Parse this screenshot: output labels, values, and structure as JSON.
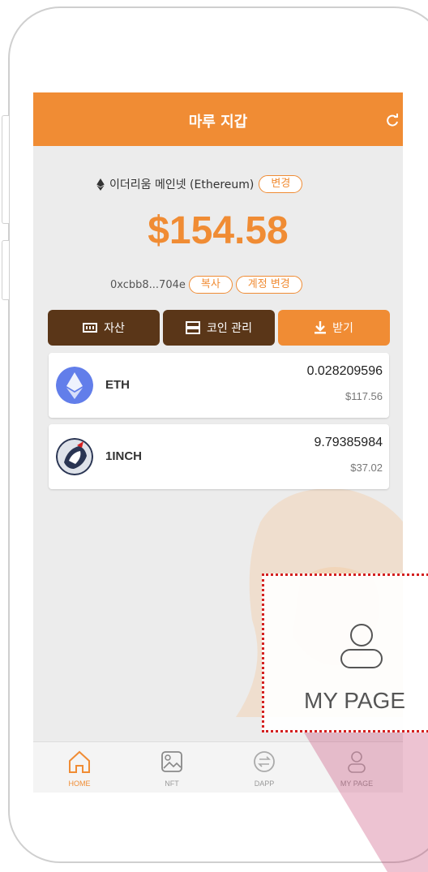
{
  "app": {
    "title": "마루 지갑"
  },
  "network": {
    "label": "이더리움 메인넷 (Ethereum)",
    "change_label": "변경"
  },
  "balance": {
    "total": "$154.58"
  },
  "account": {
    "address": "0xcbb8...704e",
    "copy_label": "복사",
    "switch_label": "계정 변경"
  },
  "actions": {
    "assets": "자산",
    "manage": "코인 관리",
    "receive": "받기"
  },
  "coins": [
    {
      "symbol": "ETH",
      "amount": "0.028209596",
      "usd": "$117.56"
    },
    {
      "symbol": "1INCH",
      "amount": "9.79385984",
      "usd": "$37.02"
    }
  ],
  "tabs": [
    {
      "label": "HOME",
      "icon": "home-icon",
      "active": true
    },
    {
      "label": "NFT",
      "icon": "image-icon"
    },
    {
      "label": "DAPP",
      "icon": "dapp-icon"
    },
    {
      "label": "MY PAGE",
      "icon": "user-icon"
    }
  ],
  "highlight": {
    "label": "MY PAGE",
    "icon": "user-icon"
  },
  "colors": {
    "accent": "#f08c34",
    "dark": "#5a3618",
    "highlight_border": "#d42020"
  }
}
